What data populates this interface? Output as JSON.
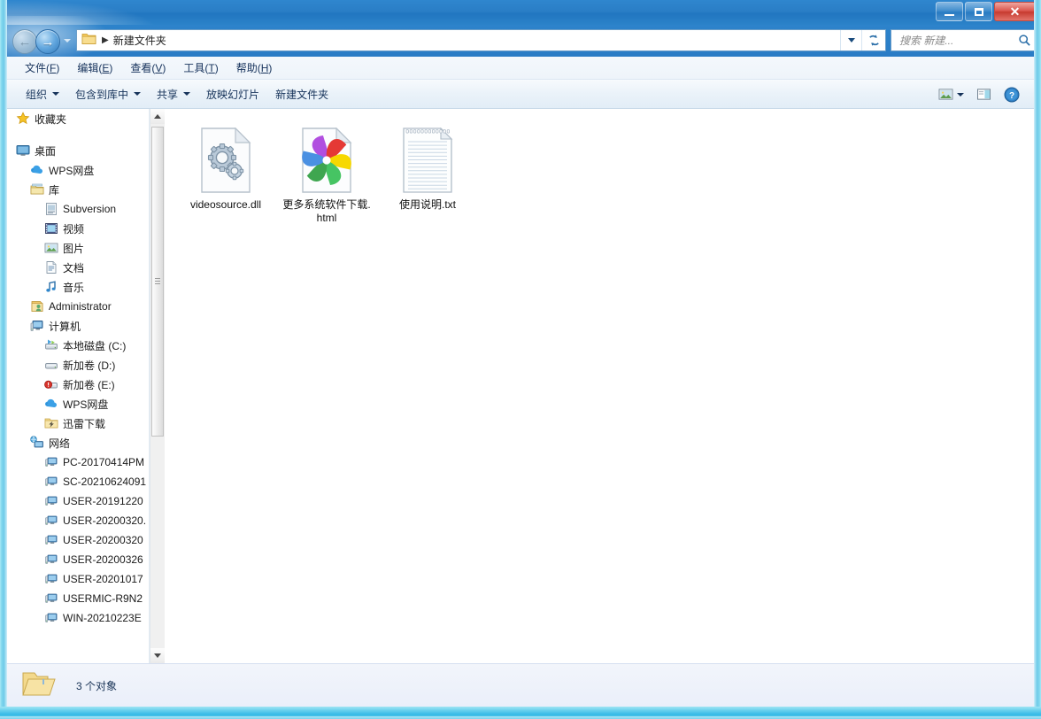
{
  "window": {
    "controls": {
      "minimize": "最小化",
      "maximize": "最大化",
      "close": "关闭"
    }
  },
  "address": {
    "back_label": "后退",
    "forward_label": "前进",
    "recent_label": "最近浏览的位置",
    "separator": "▶",
    "crumb": "新建文件夹",
    "dropdown_label": "以前的位置",
    "refresh_label": "刷新"
  },
  "search": {
    "placeholder": "搜索 新建...",
    "value": "",
    "icon": "search-icon"
  },
  "menubar": {
    "items": [
      {
        "text": "文件",
        "accel": "F"
      },
      {
        "text": "编辑",
        "accel": "E"
      },
      {
        "text": "查看",
        "accel": "V"
      },
      {
        "text": "工具",
        "accel": "T"
      },
      {
        "text": "帮助",
        "accel": "H"
      }
    ]
  },
  "toolbar": {
    "items": [
      {
        "label": "组织",
        "has_caret": true
      },
      {
        "label": "包含到库中",
        "has_caret": true
      },
      {
        "label": "共享",
        "has_caret": true
      },
      {
        "label": "放映幻灯片",
        "has_caret": false
      },
      {
        "label": "新建文件夹",
        "has_caret": false
      }
    ],
    "right": {
      "view_label": "更改您的视图",
      "view_caret": true,
      "preview_label": "显示预览窗格",
      "help_label": "获取帮助"
    }
  },
  "sidebar": {
    "nodes": [
      {
        "label": "收藏夹",
        "icon": "star-icon",
        "indent": 0,
        "spacer_after": true
      },
      {
        "label": "桌面",
        "icon": "desktop-icon",
        "indent": 0
      },
      {
        "label": "WPS网盘",
        "icon": "cloud-icon",
        "indent": 1
      },
      {
        "label": "库",
        "icon": "library-icon",
        "indent": 1
      },
      {
        "label": "Subversion",
        "icon": "subversion-icon",
        "indent": 2
      },
      {
        "label": "视频",
        "icon": "video-icon",
        "indent": 2
      },
      {
        "label": "图片",
        "icon": "pictures-icon",
        "indent": 2
      },
      {
        "label": "文档",
        "icon": "documents-icon",
        "indent": 2
      },
      {
        "label": "音乐",
        "icon": "music-icon",
        "indent": 2
      },
      {
        "label": "Administrator",
        "icon": "user-icon",
        "indent": 1
      },
      {
        "label": "计算机",
        "icon": "computer-icon",
        "indent": 1
      },
      {
        "label": "本地磁盘 (C:)",
        "icon": "system-drive-icon",
        "indent": 2
      },
      {
        "label": "新加卷 (D:)",
        "icon": "drive-icon",
        "indent": 2
      },
      {
        "label": "新加卷 (E:)",
        "icon": "drive-warning-icon",
        "indent": 2
      },
      {
        "label": "WPS网盘",
        "icon": "cloud-icon",
        "indent": 2
      },
      {
        "label": "迅雷下载",
        "icon": "thunder-folder-icon",
        "indent": 2
      },
      {
        "label": "网络",
        "icon": "network-icon",
        "indent": 1
      },
      {
        "label": "PC-20170414PM",
        "icon": "pc-icon",
        "indent": 2
      },
      {
        "label": "SC-20210624091",
        "icon": "pc-icon",
        "indent": 2
      },
      {
        "label": "USER-20191220",
        "icon": "pc-icon",
        "indent": 2
      },
      {
        "label": "USER-20200320.",
        "icon": "pc-icon",
        "indent": 2
      },
      {
        "label": "USER-20200320",
        "icon": "pc-icon",
        "indent": 2
      },
      {
        "label": "USER-20200326",
        "icon": "pc-icon",
        "indent": 2
      },
      {
        "label": "USER-20201017",
        "icon": "pc-icon",
        "indent": 2
      },
      {
        "label": "USERMIC-R9N2",
        "icon": "pc-icon",
        "indent": 2
      },
      {
        "label": "WIN-20210223E",
        "icon": "pc-icon",
        "indent": 2
      }
    ],
    "scrollbar": {
      "up_label": "向上滚动",
      "down_label": "向下滚动"
    }
  },
  "files": [
    {
      "name": "videosource.dll",
      "icon": "dll-gears-icon"
    },
    {
      "name": "更多系统软件下载.html",
      "icon": "html-pinwheel-icon"
    },
    {
      "name": "使用说明.txt",
      "icon": "text-file-icon"
    }
  ],
  "statusbar": {
    "icon": "open-folder-icon",
    "text": "3 个对象"
  },
  "colors": {
    "titlebar": "#2176c0",
    "frame_glass": "#7fd6ee",
    "accent_blue": "#2f79bb",
    "text_dark": "#1a1a1a"
  }
}
